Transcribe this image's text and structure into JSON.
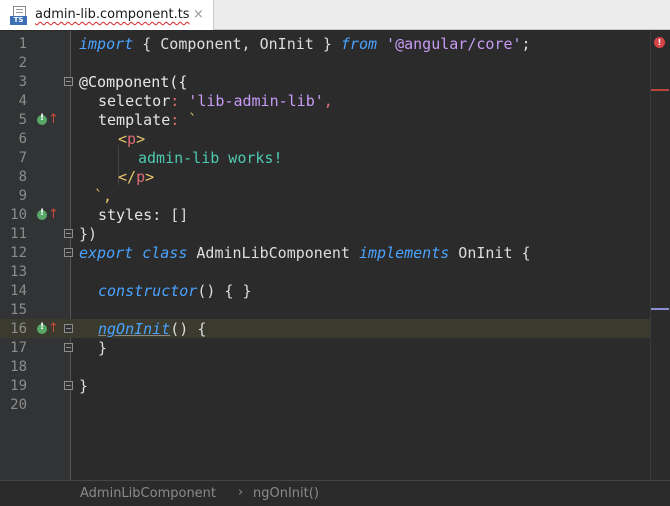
{
  "tab": {
    "title": "admin-lib.component.ts",
    "close": "×",
    "icon": "typescript-file-icon",
    "icon_label": "TS"
  },
  "line_numbers": [
    "1",
    "2",
    "3",
    "4",
    "5",
    "6",
    "7",
    "8",
    "9",
    "10",
    "11",
    "12",
    "13",
    "14",
    "15",
    "16",
    "17",
    "18",
    "19",
    "20"
  ],
  "code": {
    "l1_import": "import",
    "l1_b": " { Component, OnInit } ",
    "l1_from": "from",
    "l1_path": " '@angular/core'",
    "l1_semi": ";",
    "l3": "@Component({",
    "l4_key": "selector",
    "l4_colon": ":",
    "l4_val": " 'lib-admin-lib'",
    "l4_comma": ",",
    "l5_key": "template",
    "l5_colon": ":",
    "l5_tick": " `",
    "l6_open": "<",
    "l6_tag": "p",
    "l6_close": ">",
    "l7": "admin-lib works!",
    "l8_open": "</",
    "l8_tag": "p",
    "l8_close": ">",
    "l9": "`,",
    "l10_key": "styles",
    "l10_rest": ": []",
    "l11": "})",
    "l12_export": "export",
    "l12_class": "class",
    "l12_name": " AdminLibComponent ",
    "l12_impl": "implements",
    "l12_rest": " OnInit {",
    "l14_fn": "constructor",
    "l14_rest": "() { }",
    "l16_fn": "ngOnInit",
    "l16_rest": "() {",
    "l17": "}",
    "l19": "}"
  },
  "breadcrumb": {
    "items": [
      "AdminLibComponent",
      "ngOnInit()"
    ],
    "separator": "›"
  },
  "error_indicator": "!",
  "colors": {
    "keyword": "#4aa3ff",
    "string": "#c89bf5",
    "tag": "#e8c76a",
    "error": "#d64545",
    "override_marker": "#59a869"
  }
}
